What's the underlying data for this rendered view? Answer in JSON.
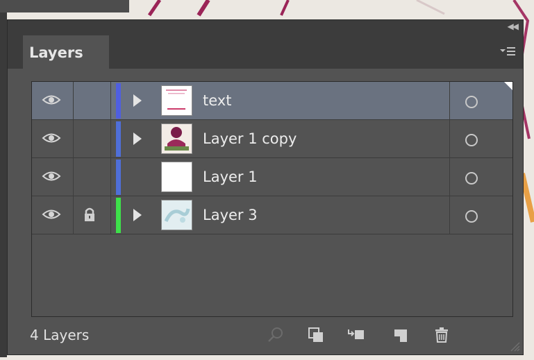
{
  "panel": {
    "tab_label": "Layers",
    "collapse_icon": "double-chevron-left-icon",
    "menu_icon": "panel-menu-icon"
  },
  "layers": [
    {
      "name": "text",
      "visible": true,
      "locked": false,
      "has_children": true,
      "selected": true,
      "color": "#4f5fe0",
      "thumb": "text-thumb"
    },
    {
      "name": "Layer 1 copy",
      "visible": true,
      "locked": false,
      "has_children": true,
      "selected": false,
      "color": "#4f6fd8",
      "thumb": "figure-thumb"
    },
    {
      "name": "Layer 1",
      "visible": true,
      "locked": false,
      "has_children": false,
      "selected": false,
      "color": "#4f6fd8",
      "thumb": "blank-thumb"
    },
    {
      "name": "Layer 3",
      "visible": true,
      "locked": true,
      "has_children": true,
      "selected": false,
      "color": "#3ee04a",
      "thumb": "map-thumb"
    }
  ],
  "footer": {
    "count_label": "4 Layers",
    "buttons": [
      "locate-object-icon",
      "make-clipping-mask-icon",
      "create-sublayer-icon",
      "new-layer-icon",
      "delete-icon"
    ]
  }
}
